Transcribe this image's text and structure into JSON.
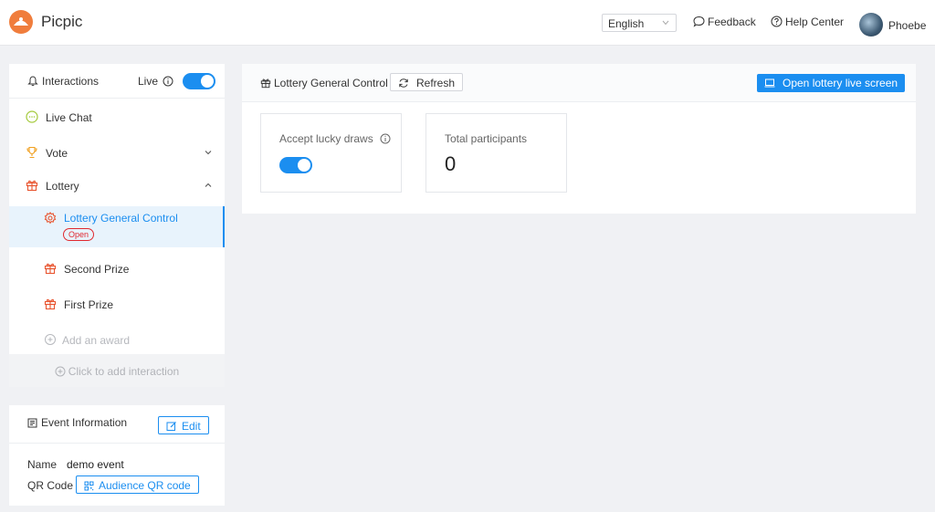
{
  "app": {
    "name": "Picpic"
  },
  "header": {
    "language": "English",
    "feedback": "Feedback",
    "help_center": "Help Center",
    "user_name": "Phoebe"
  },
  "sidebar": {
    "title": "Interactions",
    "live_label": "Live",
    "live_on": true,
    "items": [
      {
        "label": "Live Chat"
      },
      {
        "label": "Vote"
      },
      {
        "label": "Lottery"
      }
    ],
    "lottery_children": [
      {
        "label": "Lottery General Control",
        "badge": "Open"
      },
      {
        "label": "Second Prize"
      },
      {
        "label": "First Prize"
      }
    ],
    "add_award": "Add an award",
    "add_interaction": "Click to add interaction"
  },
  "event_info": {
    "title": "Event Information",
    "edit_label": "Edit",
    "name_label": "Name",
    "name_value": "demo event",
    "qr_label": "QR Code",
    "qr_button": "Audience QR code"
  },
  "main": {
    "title": "Lottery General Control",
    "refresh_label": "Refresh",
    "open_screen_label": "Open lottery live screen",
    "cards": [
      {
        "label": "Accept lucky draws",
        "toggle_on": true
      },
      {
        "label": "Total participants",
        "value": "0"
      }
    ]
  },
  "colors": {
    "accent": "#1b8ef0",
    "brand": "#f07d3c",
    "danger": "#e0292f"
  }
}
